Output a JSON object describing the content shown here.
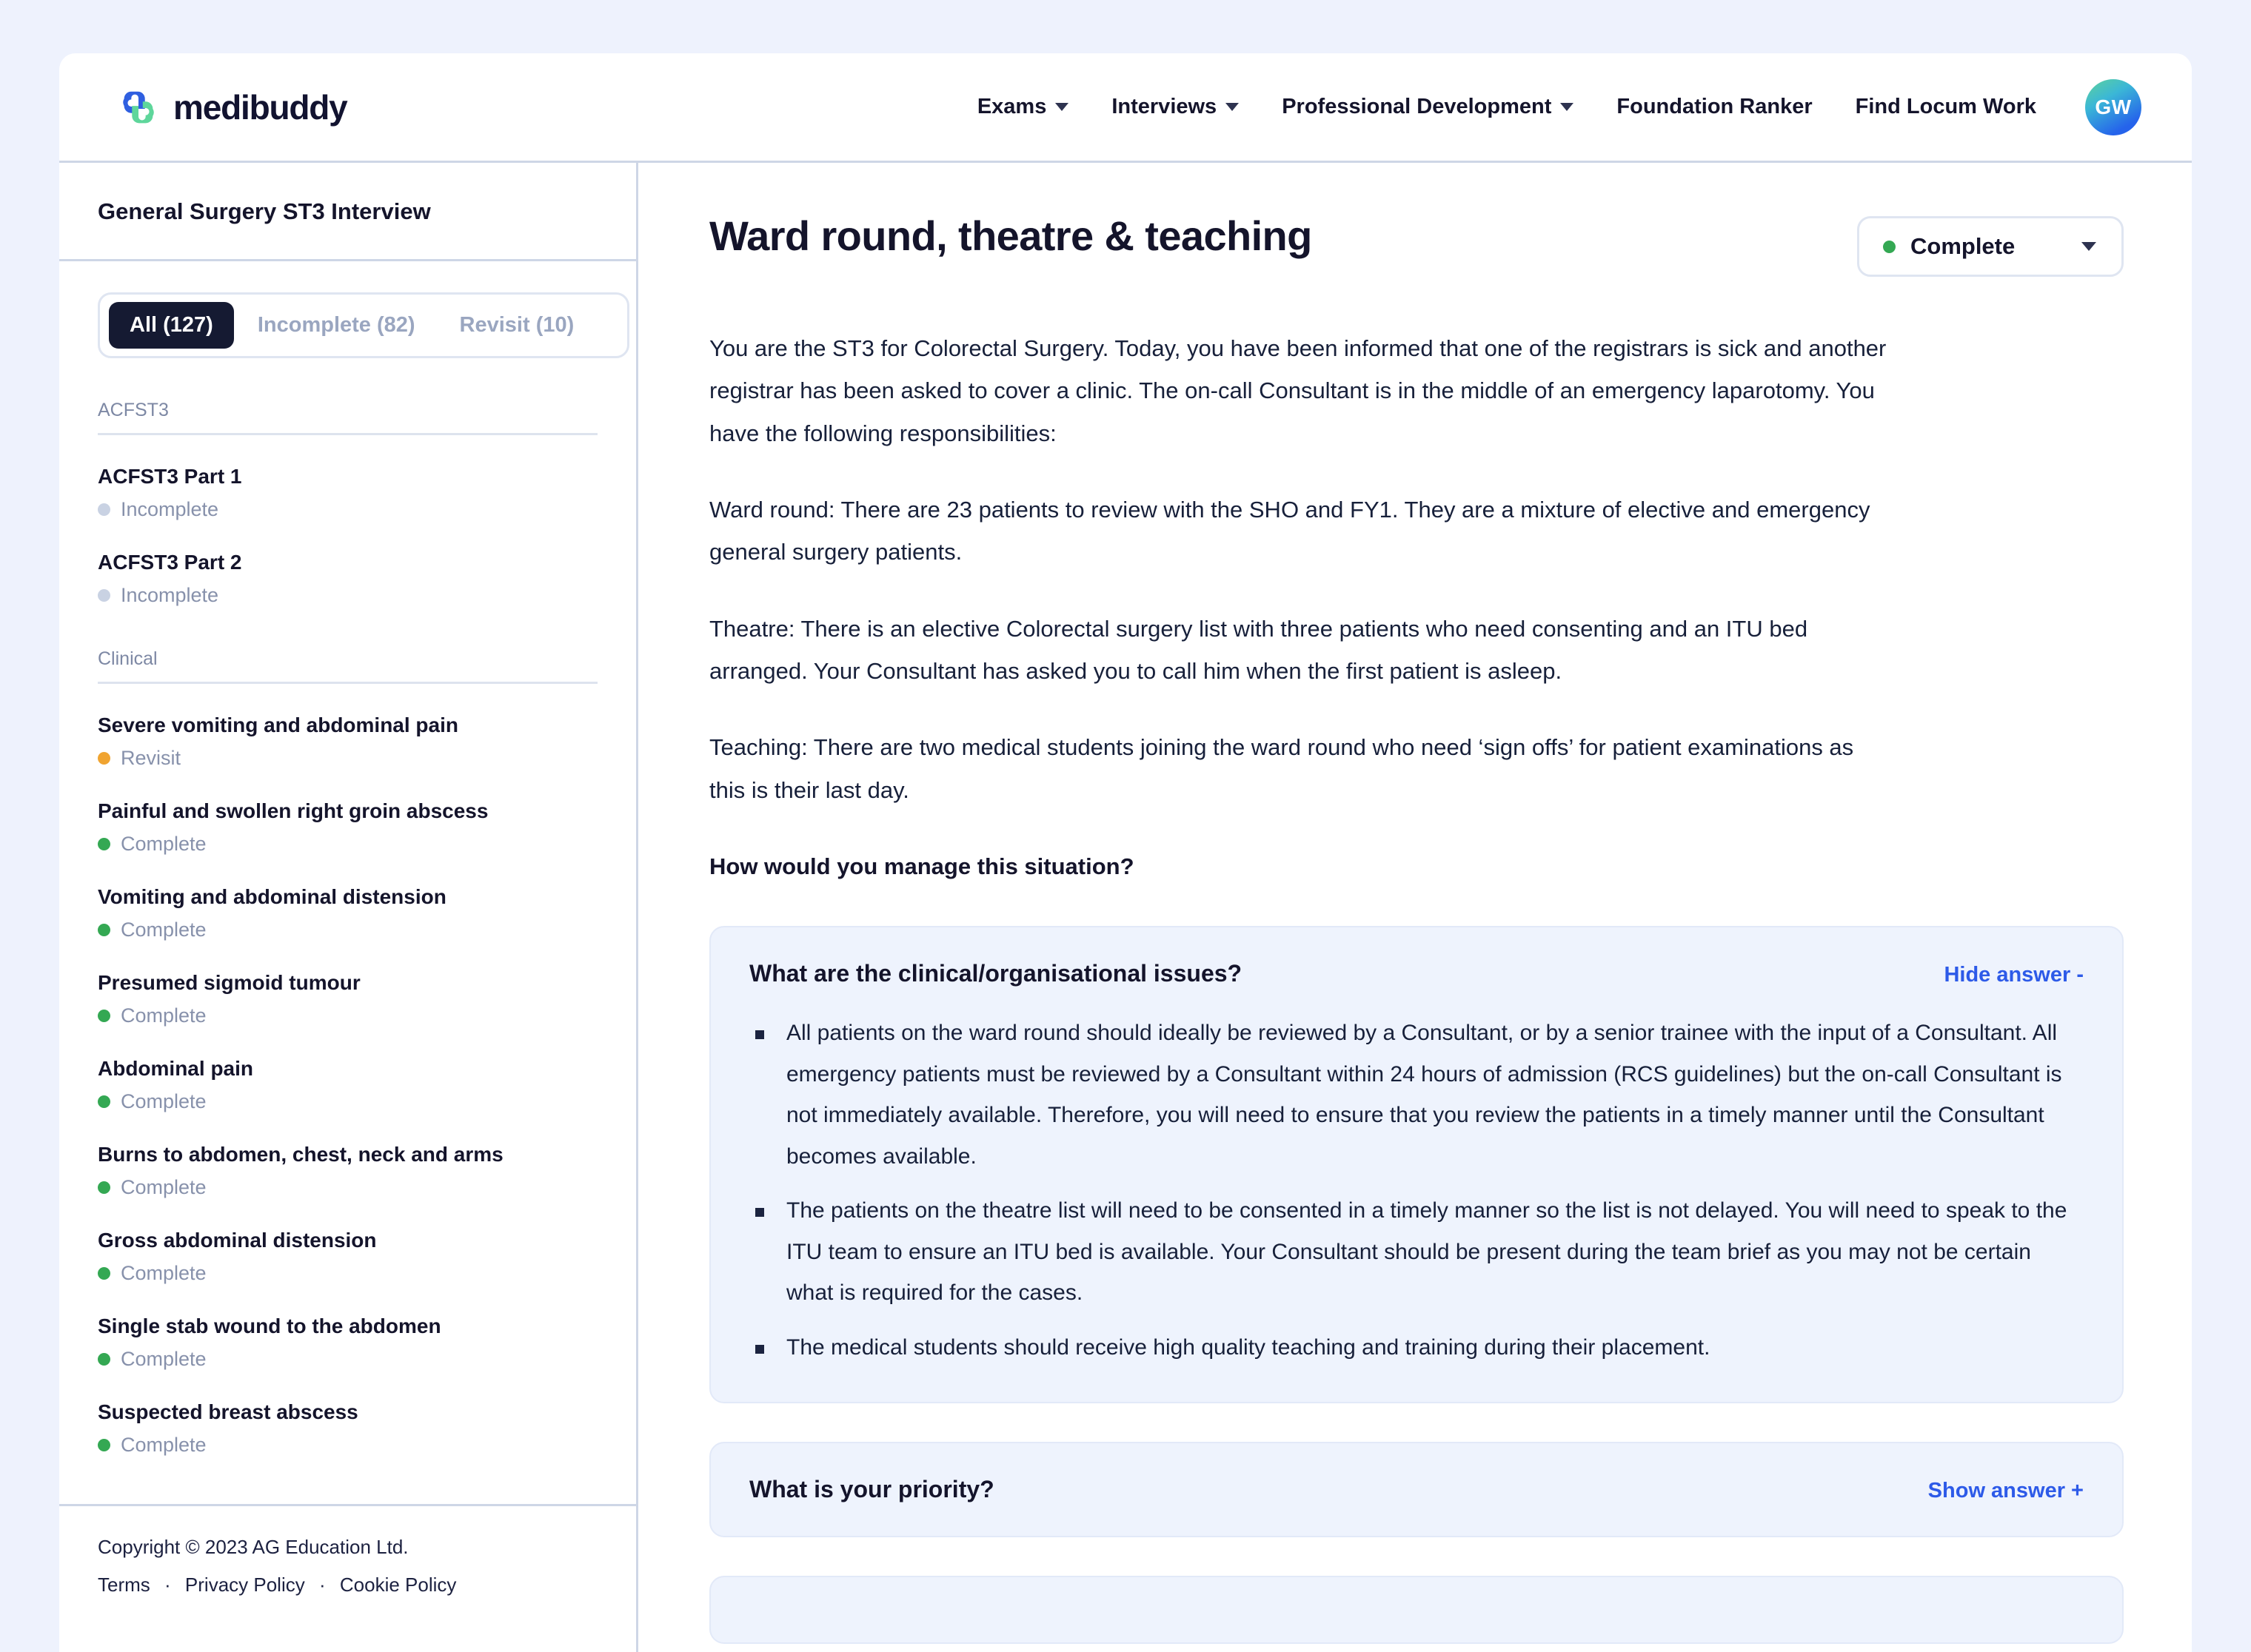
{
  "brand": {
    "name": "medibuddy",
    "mark": "medibuddy-logo-mark"
  },
  "nav": {
    "items": [
      {
        "label": "Exams",
        "has_chevron": true
      },
      {
        "label": "Interviews",
        "has_chevron": true
      },
      {
        "label": "Professional Development",
        "has_chevron": true
      },
      {
        "label": "Foundation Ranker",
        "has_chevron": false
      },
      {
        "label": "Find Locum Work",
        "has_chevron": false
      }
    ],
    "avatar_initials": "GW"
  },
  "sidebar": {
    "title": "General Surgery ST3 Interview",
    "filters": [
      {
        "label": "All (127)",
        "active": true
      },
      {
        "label": "Incomplete (82)",
        "active": false
      },
      {
        "label": "Revisit (10)",
        "active": false
      }
    ],
    "groups": [
      {
        "label": "ACFST3",
        "items": [
          {
            "title": "ACFST3 Part 1",
            "status": "Incomplete",
            "status_color": "#c9d2e3"
          },
          {
            "title": "ACFST3 Part 2",
            "status": "Incomplete",
            "status_color": "#c9d2e3"
          }
        ]
      },
      {
        "label": "Clinical",
        "items": [
          {
            "title": "Severe vomiting and abdominal pain",
            "status": "Revisit",
            "status_color": "#f0a431"
          },
          {
            "title": "Painful and swollen right groin abscess",
            "status": "Complete",
            "status_color": "#34a853"
          },
          {
            "title": "Vomiting and abdominal distension",
            "status": "Complete",
            "status_color": "#34a853"
          },
          {
            "title": "Presumed sigmoid tumour",
            "status": "Complete",
            "status_color": "#34a853"
          },
          {
            "title": "Abdominal pain",
            "status": "Complete",
            "status_color": "#34a853"
          },
          {
            "title": "Burns to abdomen, chest, neck and arms",
            "status": "Complete",
            "status_color": "#34a853"
          },
          {
            "title": "Gross abdominal distension",
            "status": "Complete",
            "status_color": "#34a853"
          },
          {
            "title": "Single stab wound to the abdomen",
            "status": "Complete",
            "status_color": "#34a853"
          },
          {
            "title": "Suspected breast abscess",
            "status": "Complete",
            "status_color": "#34a853"
          }
        ]
      }
    ],
    "footer": {
      "copyright": "Copyright © 2023 AG Education Ltd.",
      "links": [
        "Terms",
        "Privacy Policy",
        "Cookie Policy"
      ],
      "separator": "·"
    }
  },
  "main": {
    "title": "Ward round, theatre & teaching",
    "status": {
      "label": "Complete",
      "color": "#34a853"
    },
    "paragraphs": [
      "You are the ST3 for Colorectal Surgery. Today, you have been informed that one of the registrars is sick and another registrar has been asked to cover a clinic. The on-call Consultant is in the middle of an emergency laparotomy. You have the following responsibilities:",
      "Ward round: There are 23 patients to review with the SHO and FY1. They are a mixture of elective and emergency general surgery patients.",
      "Theatre: There is an elective Colorectal surgery list with three patients who need consenting and an ITU bed arranged. Your Consultant has asked you to call him when the first patient is asleep.",
      "Teaching: There are two medical students joining the ward round who need ‘sign offs’ for patient examinations as this is their last day."
    ],
    "prompt": "How would you manage this situation?",
    "questions": [
      {
        "question": "What are the clinical/organisational issues?",
        "toggle": "Hide answer -",
        "expanded": true,
        "bullets": [
          "All patients on the ward round should ideally be reviewed by a Consultant, or by a senior trainee with the input of a Consultant. All emergency patients must be reviewed by a Consultant within 24 hours of admission (RCS guidelines) but the on-call Consultant is not immediately available. Therefore, you will need to ensure that you review the patients in a timely manner until the Consultant becomes available.",
          "The patients on the theatre list will need to be consented in a timely manner so the list is not delayed. You will need to speak to the ITU team to ensure an ITU bed is available. Your Consultant should be present during the team brief as you may not be certain what is required for the cases.",
          "The medical students should receive high quality teaching and training during their placement."
        ]
      },
      {
        "question": "What is your priority?",
        "toggle": "Show answer +",
        "expanded": false,
        "bullets": []
      }
    ]
  }
}
